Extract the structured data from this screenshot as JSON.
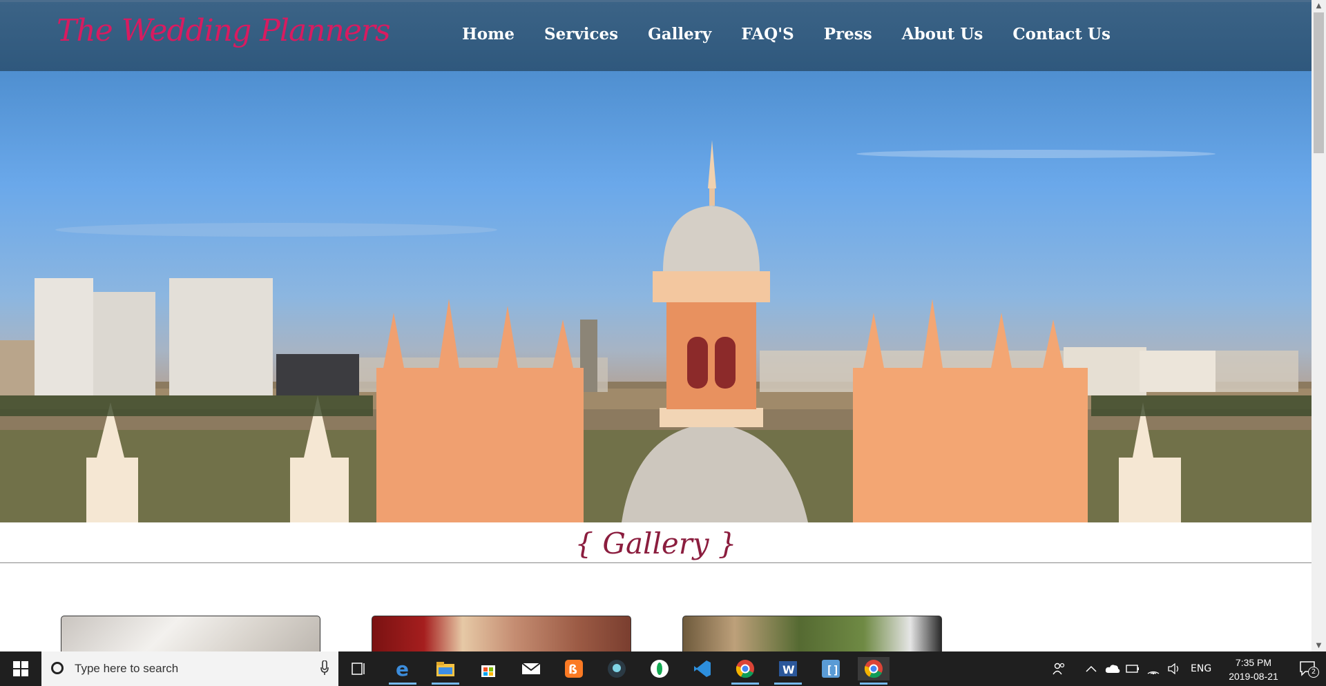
{
  "site": {
    "logo": "The Wedding Planners",
    "nav": [
      "Home",
      "Services",
      "Gallery",
      "FAQ'S",
      "Press",
      "About Us",
      "Contact Us"
    ]
  },
  "gallery": {
    "title": "{ Gallery }"
  },
  "taskbar": {
    "search_placeholder": "Type here to search",
    "apps": [
      "task-view-icon",
      "edge-icon",
      "file-explorer-icon",
      "store-icon",
      "mail-icon",
      "xampp-icon",
      "github-desktop-icon",
      "mongodb-compass-icon",
      "vscode-icon",
      "chrome-icon",
      "word-icon",
      "brackets-icon",
      "chrome-active-icon"
    ],
    "tray": {
      "language": "ENG",
      "time": "7:35 PM",
      "date": "2019-08-21",
      "notification_count": "2"
    }
  },
  "colors": {
    "nav_bg": "#2f587d",
    "logo": "#d81b60",
    "gallery_title": "#8b1d3e",
    "taskbar": "#1f1f1f"
  }
}
